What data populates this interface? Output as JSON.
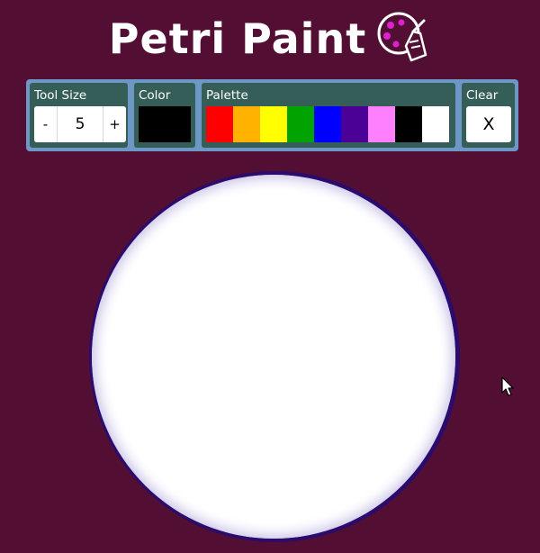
{
  "header": {
    "title": "Petri Paint",
    "logo_icon": "palette-with-hand-icon"
  },
  "toolbar": {
    "tool_size": {
      "label": "Tool Size",
      "decrement_label": "-",
      "value": "5",
      "increment_label": "+"
    },
    "color": {
      "label": "Color",
      "current": "#000000"
    },
    "palette": {
      "label": "Palette",
      "swatches": [
        "#ff0000",
        "#ffb200",
        "#ffff00",
        "#00a300",
        "#0000ff",
        "#4b0096",
        "#ff80ff",
        "#000000",
        "#ffffff"
      ]
    },
    "clear": {
      "label": "Clear",
      "button_label": "X"
    }
  },
  "colors": {
    "background": "#530e33",
    "toolbar_border": "#6d97c4",
    "panel": "#355e59",
    "canvas_rim": "#2b0b6b"
  },
  "canvas": {
    "shape": "circle",
    "fill": "#ffffff"
  },
  "cursor_icon": "arrow-cursor-icon"
}
